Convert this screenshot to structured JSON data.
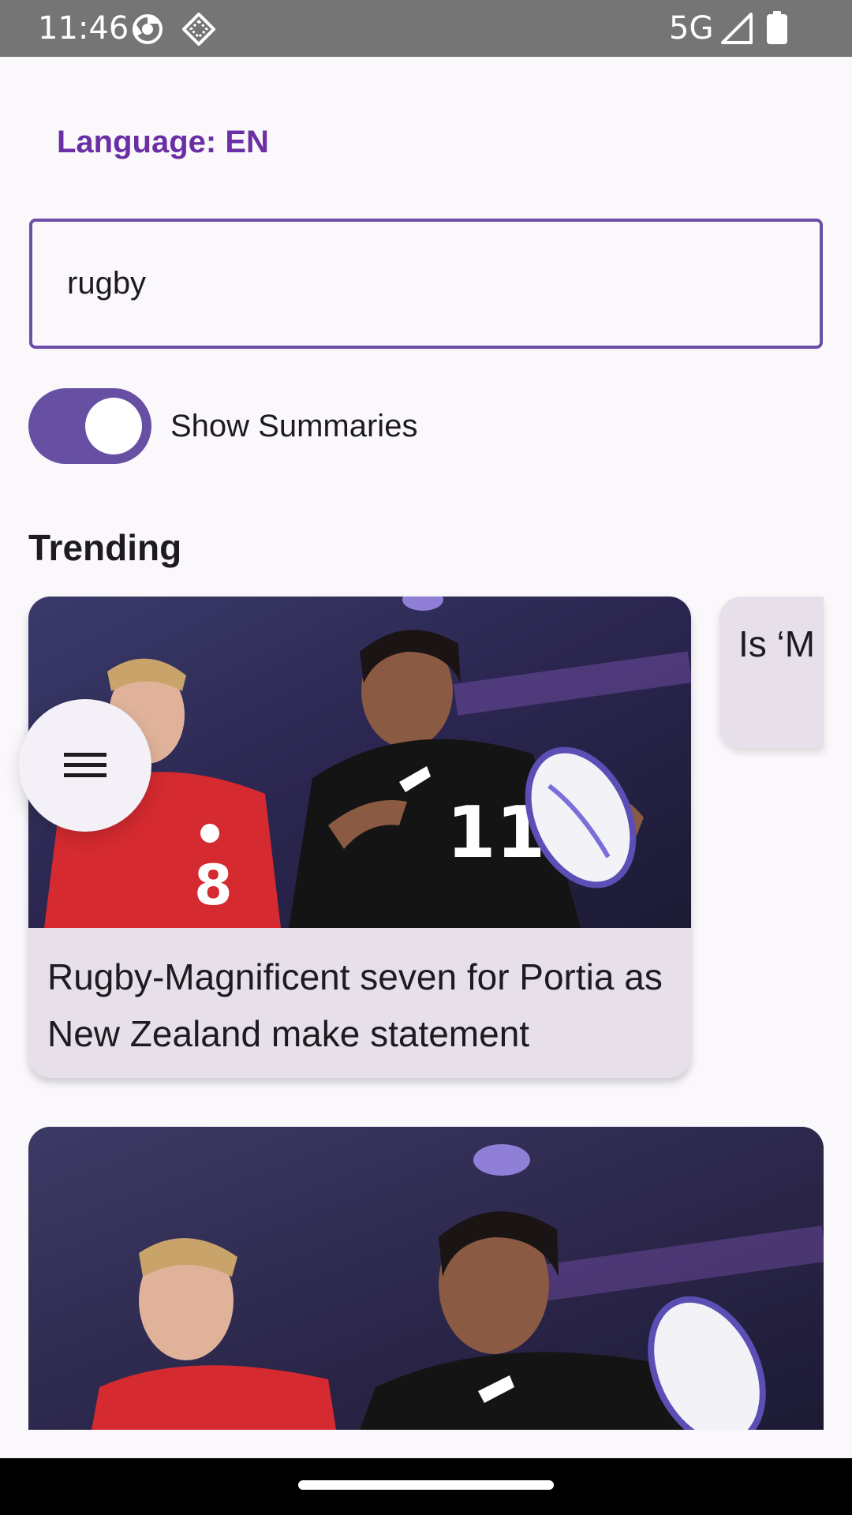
{
  "status_bar": {
    "time": "11:46",
    "network": "5G",
    "icons": [
      "chrome-icon",
      "diamond-icon",
      "signal-icon",
      "battery-icon"
    ]
  },
  "header": {
    "language_label": "Language: EN"
  },
  "search": {
    "value": "rugby"
  },
  "toggle": {
    "label": "Show Summaries",
    "checked": true
  },
  "trending": {
    "title": "Trending",
    "cards": [
      {
        "title": "Rugby-Magnificent seven for Portia as New Zealand make statement",
        "image": "rugby-player-photo"
      },
      {
        "title": "Is ‘M Reck"
      }
    ]
  },
  "fab": {
    "icon": "menu-icon"
  },
  "colors": {
    "accent": "#6750a4",
    "language": "#6a2fa5",
    "card_bg": "#e7e0ea",
    "status_bar": "#757575"
  }
}
